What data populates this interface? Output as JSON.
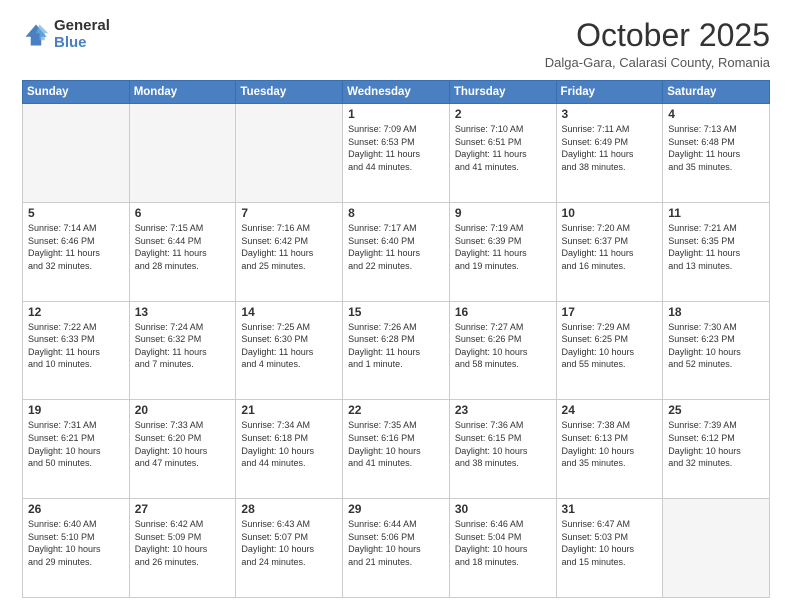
{
  "logo": {
    "general": "General",
    "blue": "Blue"
  },
  "header": {
    "month": "October 2025",
    "location": "Dalga-Gara, Calarasi County, Romania"
  },
  "weekdays": [
    "Sunday",
    "Monday",
    "Tuesday",
    "Wednesday",
    "Thursday",
    "Friday",
    "Saturday"
  ],
  "weeks": [
    [
      {
        "day": "",
        "info": ""
      },
      {
        "day": "",
        "info": ""
      },
      {
        "day": "",
        "info": ""
      },
      {
        "day": "1",
        "info": "Sunrise: 7:09 AM\nSunset: 6:53 PM\nDaylight: 11 hours\nand 44 minutes."
      },
      {
        "day": "2",
        "info": "Sunrise: 7:10 AM\nSunset: 6:51 PM\nDaylight: 11 hours\nand 41 minutes."
      },
      {
        "day": "3",
        "info": "Sunrise: 7:11 AM\nSunset: 6:49 PM\nDaylight: 11 hours\nand 38 minutes."
      },
      {
        "day": "4",
        "info": "Sunrise: 7:13 AM\nSunset: 6:48 PM\nDaylight: 11 hours\nand 35 minutes."
      }
    ],
    [
      {
        "day": "5",
        "info": "Sunrise: 7:14 AM\nSunset: 6:46 PM\nDaylight: 11 hours\nand 32 minutes."
      },
      {
        "day": "6",
        "info": "Sunrise: 7:15 AM\nSunset: 6:44 PM\nDaylight: 11 hours\nand 28 minutes."
      },
      {
        "day": "7",
        "info": "Sunrise: 7:16 AM\nSunset: 6:42 PM\nDaylight: 11 hours\nand 25 minutes."
      },
      {
        "day": "8",
        "info": "Sunrise: 7:17 AM\nSunset: 6:40 PM\nDaylight: 11 hours\nand 22 minutes."
      },
      {
        "day": "9",
        "info": "Sunrise: 7:19 AM\nSunset: 6:39 PM\nDaylight: 11 hours\nand 19 minutes."
      },
      {
        "day": "10",
        "info": "Sunrise: 7:20 AM\nSunset: 6:37 PM\nDaylight: 11 hours\nand 16 minutes."
      },
      {
        "day": "11",
        "info": "Sunrise: 7:21 AM\nSunset: 6:35 PM\nDaylight: 11 hours\nand 13 minutes."
      }
    ],
    [
      {
        "day": "12",
        "info": "Sunrise: 7:22 AM\nSunset: 6:33 PM\nDaylight: 11 hours\nand 10 minutes."
      },
      {
        "day": "13",
        "info": "Sunrise: 7:24 AM\nSunset: 6:32 PM\nDaylight: 11 hours\nand 7 minutes."
      },
      {
        "day": "14",
        "info": "Sunrise: 7:25 AM\nSunset: 6:30 PM\nDaylight: 11 hours\nand 4 minutes."
      },
      {
        "day": "15",
        "info": "Sunrise: 7:26 AM\nSunset: 6:28 PM\nDaylight: 11 hours\nand 1 minute."
      },
      {
        "day": "16",
        "info": "Sunrise: 7:27 AM\nSunset: 6:26 PM\nDaylight: 10 hours\nand 58 minutes."
      },
      {
        "day": "17",
        "info": "Sunrise: 7:29 AM\nSunset: 6:25 PM\nDaylight: 10 hours\nand 55 minutes."
      },
      {
        "day": "18",
        "info": "Sunrise: 7:30 AM\nSunset: 6:23 PM\nDaylight: 10 hours\nand 52 minutes."
      }
    ],
    [
      {
        "day": "19",
        "info": "Sunrise: 7:31 AM\nSunset: 6:21 PM\nDaylight: 10 hours\nand 50 minutes."
      },
      {
        "day": "20",
        "info": "Sunrise: 7:33 AM\nSunset: 6:20 PM\nDaylight: 10 hours\nand 47 minutes."
      },
      {
        "day": "21",
        "info": "Sunrise: 7:34 AM\nSunset: 6:18 PM\nDaylight: 10 hours\nand 44 minutes."
      },
      {
        "day": "22",
        "info": "Sunrise: 7:35 AM\nSunset: 6:16 PM\nDaylight: 10 hours\nand 41 minutes."
      },
      {
        "day": "23",
        "info": "Sunrise: 7:36 AM\nSunset: 6:15 PM\nDaylight: 10 hours\nand 38 minutes."
      },
      {
        "day": "24",
        "info": "Sunrise: 7:38 AM\nSunset: 6:13 PM\nDaylight: 10 hours\nand 35 minutes."
      },
      {
        "day": "25",
        "info": "Sunrise: 7:39 AM\nSunset: 6:12 PM\nDaylight: 10 hours\nand 32 minutes."
      }
    ],
    [
      {
        "day": "26",
        "info": "Sunrise: 6:40 AM\nSunset: 5:10 PM\nDaylight: 10 hours\nand 29 minutes."
      },
      {
        "day": "27",
        "info": "Sunrise: 6:42 AM\nSunset: 5:09 PM\nDaylight: 10 hours\nand 26 minutes."
      },
      {
        "day": "28",
        "info": "Sunrise: 6:43 AM\nSunset: 5:07 PM\nDaylight: 10 hours\nand 24 minutes."
      },
      {
        "day": "29",
        "info": "Sunrise: 6:44 AM\nSunset: 5:06 PM\nDaylight: 10 hours\nand 21 minutes."
      },
      {
        "day": "30",
        "info": "Sunrise: 6:46 AM\nSunset: 5:04 PM\nDaylight: 10 hours\nand 18 minutes."
      },
      {
        "day": "31",
        "info": "Sunrise: 6:47 AM\nSunset: 5:03 PM\nDaylight: 10 hours\nand 15 minutes."
      },
      {
        "day": "",
        "info": ""
      }
    ]
  ]
}
